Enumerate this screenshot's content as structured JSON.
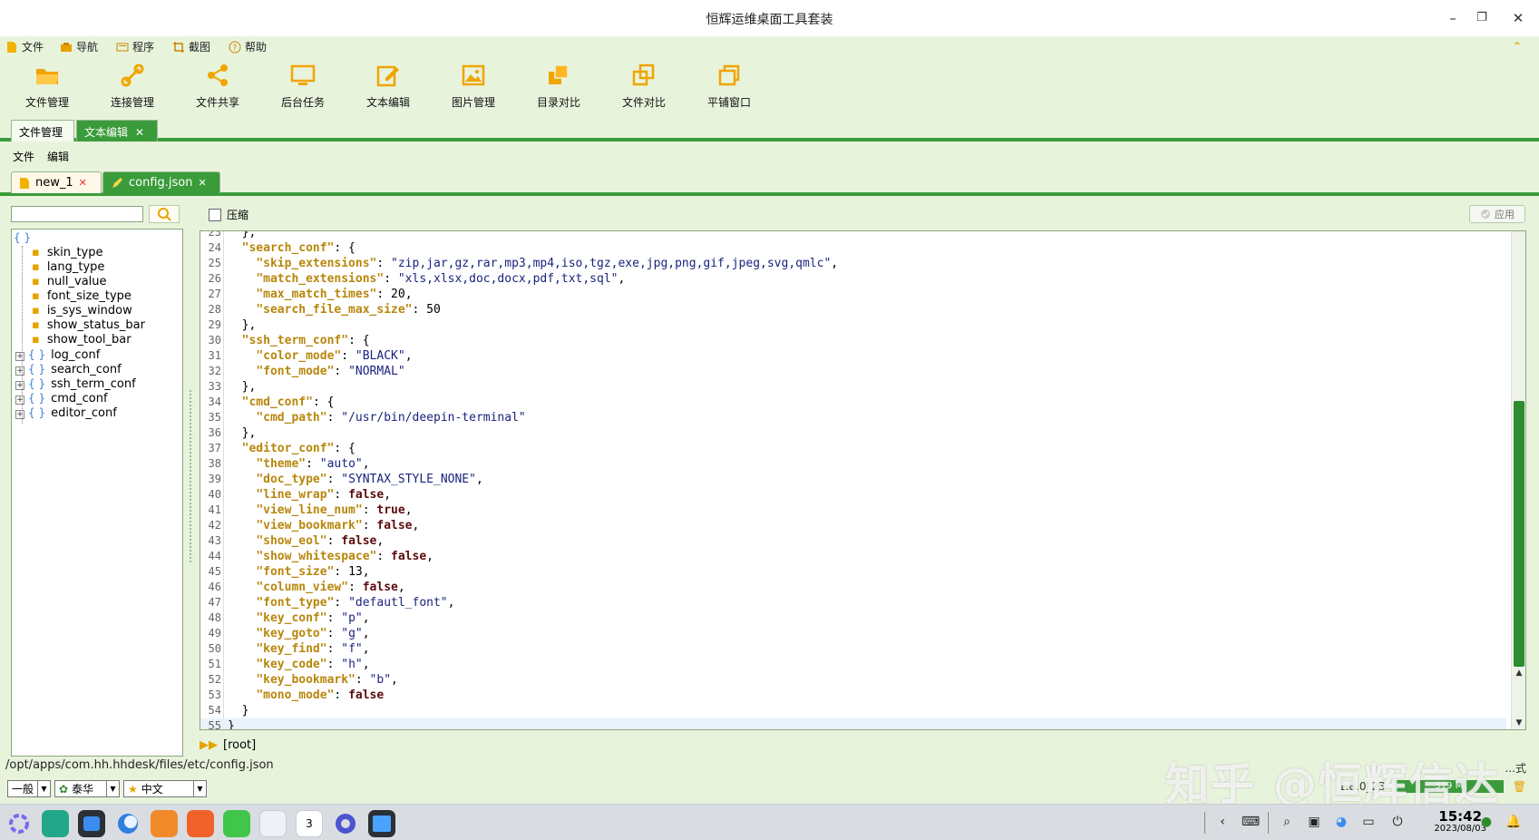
{
  "window": {
    "title": "恒辉运维桌面工具套装",
    "minimize": "–",
    "restore": "❐",
    "close": "✕"
  },
  "menubar": {
    "items": [
      {
        "label": "文件",
        "icon": "file-icon"
      },
      {
        "label": "导航",
        "icon": "navigation-icon"
      },
      {
        "label": "程序",
        "icon": "program-icon"
      },
      {
        "label": "截图",
        "icon": "crop-icon"
      },
      {
        "label": "帮助",
        "icon": "help-icon"
      }
    ],
    "collapse": "⌃"
  },
  "toolbar": {
    "items": [
      {
        "label": "文件管理",
        "icon": "folder-open-icon"
      },
      {
        "label": "连接管理",
        "icon": "link-icon"
      },
      {
        "label": "文件共享",
        "icon": "share-icon"
      },
      {
        "label": "后台任务",
        "icon": "monitor-icon"
      },
      {
        "label": "文本编辑",
        "icon": "edit-icon"
      },
      {
        "label": "图片管理",
        "icon": "image-icon"
      },
      {
        "label": "目录对比",
        "icon": "folder-compare-icon"
      },
      {
        "label": "文件对比",
        "icon": "file-compare-icon"
      },
      {
        "label": "平铺窗口",
        "icon": "tile-windows-icon"
      }
    ]
  },
  "outer_tabs": [
    {
      "label": "文件管理",
      "active": false
    },
    {
      "label": "文本编辑",
      "active": true,
      "close": "✕"
    }
  ],
  "submenu": {
    "file": "文件",
    "edit": "编辑"
  },
  "file_tabs": [
    {
      "label": "new_1",
      "active": false,
      "close": "✕"
    },
    {
      "label": "config.json",
      "active": true,
      "close": "✕"
    }
  ],
  "left_panel": {
    "search_value": "",
    "root": "{ }",
    "leaf_nodes": [
      "skin_type",
      "lang_type",
      "null_value",
      "font_size_type",
      "is_sys_window",
      "show_status_bar",
      "show_tool_bar"
    ],
    "object_nodes": [
      "log_conf",
      "search_conf",
      "ssh_term_conf",
      "cmd_conf",
      "editor_conf"
    ]
  },
  "editor_toolbar": {
    "compress_label": "压缩",
    "compress_checked": false,
    "apply_label": "应用"
  },
  "editor": {
    "first_line": 23,
    "current_line": 55,
    "lines": [
      "  },",
      "  \"search_conf\": {",
      "    \"skip_extensions\": \"zip,jar,gz,rar,mp3,mp4,iso,tgz,exe,jpg,png,gif,jpeg,svg,qmlc\",",
      "    \"match_extensions\": \"xls,xlsx,doc,docx,pdf,txt,sql\",",
      "    \"max_match_times\": 20,",
      "    \"search_file_max_size\": 50",
      "  },",
      "  \"ssh_term_conf\": {",
      "    \"color_mode\": \"BLACK\",",
      "    \"font_mode\": \"NORMAL\"",
      "  },",
      "  \"cmd_conf\": {",
      "    \"cmd_path\": \"/usr/bin/deepin-terminal\"",
      "  },",
      "  \"editor_conf\": {",
      "    \"theme\": \"auto\",",
      "    \"doc_type\": \"SYNTAX_STYLE_NONE\",",
      "    \"line_wrap\": false,",
      "    \"view_line_num\": true,",
      "    \"view_bookmark\": false,",
      "    \"show_eol\": false,",
      "    \"show_whitespace\": false,",
      "    \"font_size\": 13,",
      "    \"column_view\": false,",
      "    \"font_type\": \"defautl_font\",",
      "    \"key_conf\": \"p\",",
      "    \"key_goto\": \"g\",",
      "    \"key_find\": \"f\",",
      "    \"key_code\": \"h\",",
      "    \"key_bookmark\": \"b\",",
      "    \"mono_mode\": false",
      "  }",
      "}"
    ],
    "scroll_fraction": 0.39
  },
  "breadcrumb": {
    "arrow": "▶▶",
    "path": "[root]"
  },
  "status": {
    "file_path": "/opt/apps/com.hh.hhdesk/files/etc/config.json",
    "mode_label": "...式",
    "selectors": [
      {
        "value": "一般"
      },
      {
        "value": "泰华",
        "icon": "leaf-icon"
      },
      {
        "value": "中文",
        "icon": "star-icon"
      }
    ],
    "version": "1.8.0_23",
    "memory": "319 M"
  },
  "taskbar": {
    "apps": [
      "launcher-icon",
      "file-manager-icon",
      "store-icon",
      "browser-icon",
      "app-store-icon",
      "gallery-icon",
      "music-icon",
      "document-icon",
      "calendar-icon",
      "settings-icon",
      "hhdesk-icon"
    ],
    "calendar_day": "3",
    "time": "15:42",
    "date": "2023/08/03"
  },
  "watermark": "知乎 @恒辉信达",
  "colors": {
    "accent": "#3a9b3a",
    "background": "#e8f3dc",
    "json_key": "#b8860b",
    "json_string": "#1a237e",
    "json_bool": "#5d0c0c"
  }
}
